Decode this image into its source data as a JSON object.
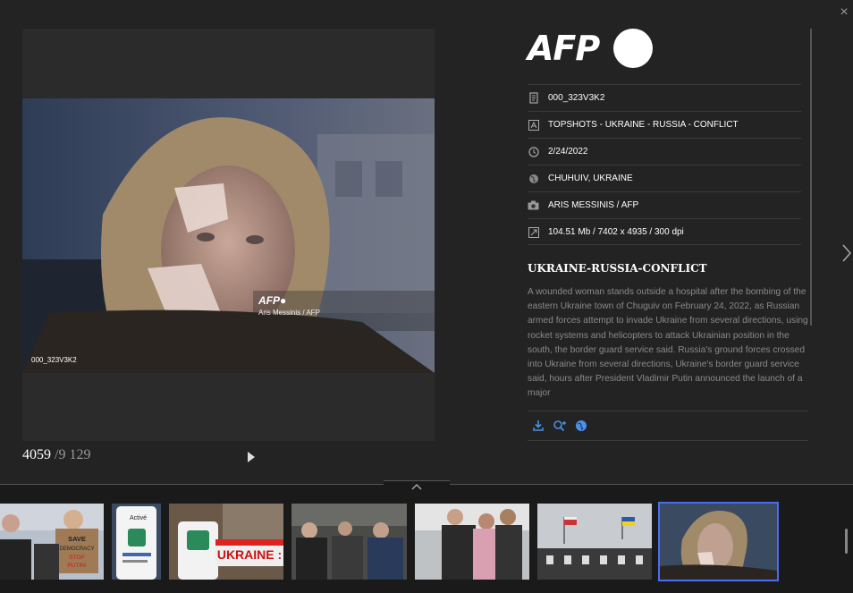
{
  "viewer": {
    "close_label": "×",
    "counter": {
      "current": "4059",
      "total": "/9 129"
    },
    "photo": {
      "id_overlay": "000_323V3K2",
      "watermark_logo": "AFP●",
      "watermark_credit": "Aris Messinis / AFP"
    }
  },
  "info": {
    "logo": "AFP",
    "meta": [
      {
        "icon": "document-icon",
        "value": "000_323V3K2"
      },
      {
        "icon": "title-icon",
        "value": "TOPSHOTS - UKRAINE - RUSSIA - CONFLICT"
      },
      {
        "icon": "clock-icon",
        "value": "2/24/2022"
      },
      {
        "icon": "globe-icon",
        "value": "CHUHUIV, UKRAINE"
      },
      {
        "icon": "camera-icon",
        "value": "ARIS MESSINIS / AFP"
      },
      {
        "icon": "resize-icon",
        "value": "104.51 Mb / 7402 x 4935 / 300 dpi"
      }
    ],
    "headline": "UKRAINE-RUSSIA-CONFLICT",
    "caption": "A wounded woman stands outside a hospital after the bombing of the eastern Ukraine town of Chuguiv on February 24, 2022, as Russian armed forces attempt to invade Ukraine from several directions, using rocket systems and helicopters to attack Ukrainian position in the south, the border guard service said. Russia's ground forces crossed into Ukraine from several directions, Ukraine's border guard service said, hours after President Vladimir Putin announced the launch of a major"
  },
  "thumbnails": [
    {
      "name": "protest-stop-putin",
      "text": "SAVE DEMOCRACY STOP PUTIN!"
    },
    {
      "name": "pass-vaccinal-app",
      "text": "Activé"
    },
    {
      "name": "edition-speciale-ukraine",
      "text": "UKRAINE :"
    },
    {
      "name": "crowd-scene",
      "text": ""
    },
    {
      "name": "family-scene",
      "text": ""
    },
    {
      "name": "flags-building",
      "text": ""
    },
    {
      "name": "wounded-woman",
      "text": ""
    }
  ],
  "colors": {
    "background": "#232323",
    "accent": "#4a6cf0",
    "icon_blue": "#4a8fe8"
  }
}
